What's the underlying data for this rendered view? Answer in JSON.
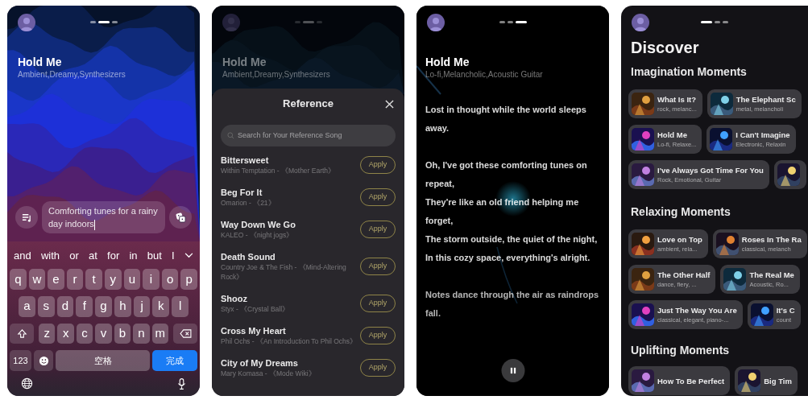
{
  "create_screen": {
    "page_indicator": [
      {
        "selected": false
      },
      {
        "selected": true
      },
      {
        "selected": false
      }
    ],
    "song_title": "Hold Me",
    "tags": "Ambient,Dreamy,Synthesizers",
    "prompt": "Comforting tunes for a rainy day indoors",
    "keyboard": {
      "suggestions": [
        "and",
        "with",
        "or",
        "at",
        "for",
        "in",
        "but",
        "I"
      ],
      "letter_rows": [
        [
          "q",
          "w",
          "e",
          "r",
          "t",
          "y",
          "u",
          "i",
          "o",
          "p"
        ],
        [
          "a",
          "s",
          "d",
          "f",
          "g",
          "h",
          "j",
          "k",
          "l"
        ],
        [
          "z",
          "x",
          "c",
          "v",
          "b",
          "n",
          "m"
        ]
      ],
      "numbers_key": "123",
      "space_key": "空格",
      "done_key": "完成"
    }
  },
  "reference_screen": {
    "page_indicator": [
      {
        "selected": false
      },
      {
        "selected": true
      },
      {
        "selected": false
      }
    ],
    "song_title": "Hold Me",
    "tags": "Ambient,Dreamy,Synthesizers",
    "sheet_title": "Reference",
    "search": {
      "placeholder": "Search for Your Reference Song"
    },
    "songs": [
      {
        "title": "Bittersweet",
        "artist_album": "Within Temptation - 《Mother Earth》",
        "button": "Apply"
      },
      {
        "title": "Beg For It",
        "artist_album": "Omarion - 《21》",
        "button": "Apply"
      },
      {
        "title": "Way Down We Go",
        "artist_album": "KALEO - 《night jogs》",
        "button": "Apply"
      },
      {
        "title": "Death Sound",
        "artist_album": "Country Joe & The Fish - 《Mind-Altering Rock》",
        "button": "Apply"
      },
      {
        "title": "Shooz",
        "artist_album": "Styx - 《Crystal Ball》",
        "button": "Apply"
      },
      {
        "title": "Cross My Heart",
        "artist_album": "Phil Ochs - 《An Introduction To Phil Ochs》",
        "button": "Apply"
      },
      {
        "title": "City of My Dreams",
        "artist_album": "Mary Komasa - 《Mode Wiki》",
        "button": "Apply"
      }
    ]
  },
  "lyrics_screen": {
    "page_indicator": [
      {
        "selected": false
      },
      {
        "selected": false
      },
      {
        "selected": true
      }
    ],
    "song_title": "Hold Me",
    "tags": "Lo-fi,Melancholic,Acoustic Guitar",
    "stanzas": [
      [
        "Lost in thought while the world sleeps away."
      ],
      [
        "Oh, I've got these comforting tunes on repeat,",
        "They're like an old friend helping me forget,",
        "The storm outside, the quiet of the night,",
        "In this cozy space, everything's alright."
      ],
      [
        "Notes dance through the air as raindrops fall."
      ]
    ],
    "playing": true
  },
  "discover_screen": {
    "page_indicator": [
      {
        "selected": true
      },
      {
        "selected": false
      },
      {
        "selected": false
      }
    ],
    "title": "Discover",
    "sections": [
      {
        "title": "Imagination Moments",
        "rows": [
          [
            {
              "kind": "song",
              "title": "What Is It?",
              "tags": "rock, melanc..."
            },
            {
              "kind": "song",
              "title": "The Elephant Sc",
              "tags": "metal, melancholi"
            }
          ],
          [
            {
              "kind": "song",
              "title": "Hold Me",
              "tags": "Lo-fi, Relaxe..."
            },
            {
              "kind": "song",
              "title": "I Can't Imagine",
              "tags": "Electronic, Relaxin"
            }
          ],
          [
            {
              "kind": "song",
              "title": "I've Always Got Time For You",
              "tags": "Rock, Emotional, Guitar"
            },
            {
              "kind": "partial"
            }
          ]
        ]
      },
      {
        "title": "Relaxing Moments",
        "rows": [
          [
            {
              "kind": "song",
              "title": "Love on Top",
              "tags": "ambient, rela..."
            },
            {
              "kind": "song",
              "title": "Roses In The Ra",
              "tags": "classical, melanch"
            }
          ],
          [
            {
              "kind": "song",
              "title": "The Other Half",
              "tags": "dance, fiery, ..."
            },
            {
              "kind": "song",
              "title": "The Real Me",
              "tags": "Acoustic, Ro..."
            }
          ],
          [
            {
              "kind": "song",
              "title": "Just The Way You Are",
              "tags": "classical, elegant, piano-..."
            },
            {
              "kind": "song",
              "title": "It's C",
              "tags": "count"
            }
          ]
        ]
      },
      {
        "title": "Uplifting Moments",
        "rows": [
          [
            {
              "kind": "song",
              "title": "How To Be Perfect"
            },
            {
              "kind": "song",
              "title": "Big Tim"
            }
          ]
        ]
      }
    ]
  }
}
